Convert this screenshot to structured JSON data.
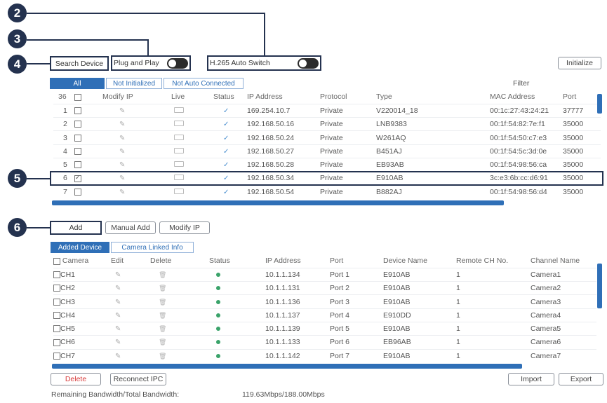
{
  "callouts": [
    "2",
    "3",
    "4",
    "5",
    "6"
  ],
  "toolbar": {
    "search_device": "Search Device",
    "plug_and_play": "Plug and Play",
    "h265_auto_switch": "H.265 Auto Switch",
    "initialize": "Initialize",
    "filter": "Filter"
  },
  "search_tabs": [
    "All",
    "Not Initialized",
    "Not Auto Connected"
  ],
  "search_table": {
    "count": "36",
    "headers": [
      "Modify IP",
      "Live",
      "Status",
      "IP Address",
      "Protocol",
      "Type",
      "MAC Address",
      "Port"
    ],
    "rows": [
      {
        "no": "1",
        "checked": false,
        "ip": "169.254.10.7",
        "protocol": "Private",
        "type": "V220014_18",
        "mac": "00:1c:27:43:24:21",
        "port": "37777"
      },
      {
        "no": "2",
        "checked": false,
        "ip": "192.168.50.16",
        "protocol": "Private",
        "type": "LNB9383",
        "mac": "00:1f:54:82:7e:f1",
        "port": "35000"
      },
      {
        "no": "3",
        "checked": false,
        "ip": "192.168.50.24",
        "protocol": "Private",
        "type": "W261AQ",
        "mac": "00:1f:54:50:c7:e3",
        "port": "35000"
      },
      {
        "no": "4",
        "checked": false,
        "ip": "192.168.50.27",
        "protocol": "Private",
        "type": "B451AJ",
        "mac": "00:1f:54:5c:3d:0e",
        "port": "35000"
      },
      {
        "no": "5",
        "checked": false,
        "ip": "192.168.50.28",
        "protocol": "Private",
        "type": "EB93AB",
        "mac": "00:1f:54:98:56:ca",
        "port": "35000"
      },
      {
        "no": "6",
        "checked": true,
        "ip": "192.168.50.34",
        "protocol": "Private",
        "type": "E910AB",
        "mac": "3c:e3:6b:cc:d6:91",
        "port": "35000"
      },
      {
        "no": "7",
        "checked": false,
        "ip": "192.168.50.54",
        "protocol": "Private",
        "type": "B882AJ",
        "mac": "00:1f:54:98:56:d4",
        "port": "35000"
      }
    ]
  },
  "actions": {
    "add": "Add",
    "manual_add": "Manual Add",
    "modify_ip": "Modify IP"
  },
  "device_tabs": [
    "Added Device",
    "Camera Linked Info"
  ],
  "device_table": {
    "headers": [
      "Camera",
      "Edit",
      "Delete",
      "Status",
      "IP Address",
      "Port",
      "Device Name",
      "Remote CH No.",
      "Channel Name"
    ],
    "rows": [
      {
        "ch": "CH1",
        "ip": "10.1.1.134",
        "port": "Port 1",
        "device": "E910AB",
        "remote": "1",
        "channel": "Camera1"
      },
      {
        "ch": "CH2",
        "ip": "10.1.1.131",
        "port": "Port 2",
        "device": "E910AB",
        "remote": "1",
        "channel": "Camera2"
      },
      {
        "ch": "CH3",
        "ip": "10.1.1.136",
        "port": "Port 3",
        "device": "E910AB",
        "remote": "1",
        "channel": "Camera3"
      },
      {
        "ch": "CH4",
        "ip": "10.1.1.137",
        "port": "Port 4",
        "device": "E910DD",
        "remote": "1",
        "channel": "Camera4"
      },
      {
        "ch": "CH5",
        "ip": "10.1.1.139",
        "port": "Port 5",
        "device": "E910AB",
        "remote": "1",
        "channel": "Camera5"
      },
      {
        "ch": "CH6",
        "ip": "10.1.1.133",
        "port": "Port 6",
        "device": "EB96AB",
        "remote": "1",
        "channel": "Camera6"
      },
      {
        "ch": "CH7",
        "ip": "10.1.1.142",
        "port": "Port 7",
        "device": "E910AB",
        "remote": "1",
        "channel": "Camera7"
      }
    ]
  },
  "footer": {
    "delete": "Delete",
    "reconnect_ipc": "Reconnect IPC",
    "import": "Import",
    "export": "Export",
    "bandwidth_label": "Remaining Bandwidth/Total Bandwidth:",
    "bandwidth_value": "119.63Mbps/188.00Mbps"
  },
  "colors": {
    "accent": "#2f6fb7",
    "callout": "#24324f",
    "delete_text": "#d83a3a",
    "status_online": "#3aa36a"
  }
}
